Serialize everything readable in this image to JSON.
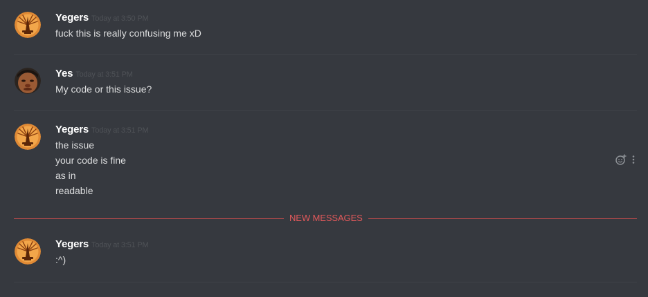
{
  "new_messages_label": "NEW MESSAGES",
  "messages": [
    {
      "username": "Yegers",
      "timestamp": "Today at 3:50 PM",
      "avatar_icon": "yegers-emblem-avatar",
      "lines": [
        "fuck this is really confusing me xD"
      ]
    },
    {
      "username": "Yes",
      "timestamp": "Today at 3:51 PM",
      "avatar_icon": "face-photo-avatar",
      "lines": [
        "My code or this issue?"
      ]
    },
    {
      "username": "Yegers",
      "timestamp": "Today at 3:51 PM",
      "avatar_icon": "yegers-emblem-avatar",
      "lines": [
        "the issue",
        "your code is fine",
        "as in",
        "readable"
      ]
    },
    {
      "username": "Yegers",
      "timestamp": "Today at 3:51 PM",
      "avatar_icon": "yegers-emblem-avatar",
      "lines": [
        ":^)"
      ]
    }
  ],
  "colors": {
    "background": "#36393f",
    "username": "#ffffff",
    "message_text": "#dcddde",
    "timestamp": "#4f5257",
    "new_messages_accent": "#e2595b"
  },
  "hover_actions": [
    "add-reaction-icon",
    "more-options-icon"
  ]
}
